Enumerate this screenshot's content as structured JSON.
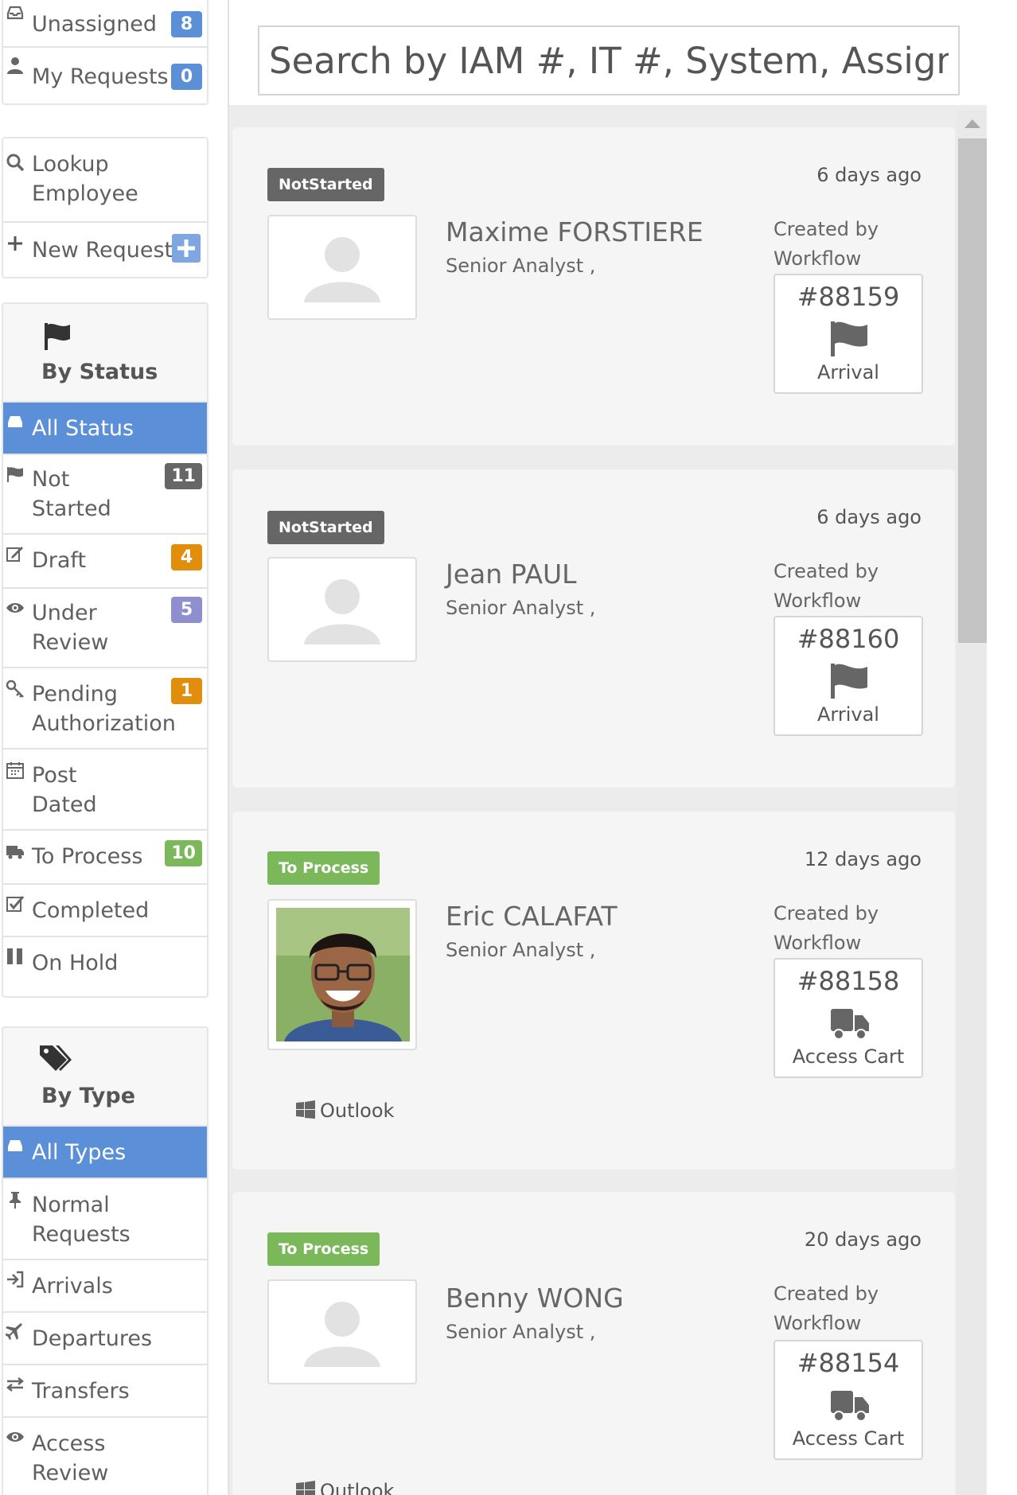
{
  "sidebar": {
    "top_items": [
      {
        "label": "Unassigned",
        "count": "8",
        "color": "#5b8fd8"
      },
      {
        "label": "My Requests",
        "count": "0",
        "color": "#5b8fd8"
      }
    ],
    "lookup_label": "Lookup Employee",
    "new_request_label": "New Request",
    "status_group": {
      "title": "By Status",
      "items": [
        {
          "label": "All Status",
          "count": ""
        },
        {
          "label": "Not Started",
          "count": "11",
          "color": "#666666"
        },
        {
          "label": "Draft",
          "count": "4",
          "color": "#e08e0b"
        },
        {
          "label": "Under Review",
          "count": "5",
          "color": "#8f8fd0"
        },
        {
          "label": "Pending Authorization",
          "count": "1",
          "color": "#e08e0b"
        },
        {
          "label": "Post Dated",
          "count": ""
        },
        {
          "label": "To Process",
          "count": "10",
          "color": "#7ab85a"
        },
        {
          "label": "Completed",
          "count": ""
        },
        {
          "label": "On Hold",
          "count": ""
        }
      ]
    },
    "type_group": {
      "title": "By Type",
      "items": [
        {
          "label": "All Types"
        },
        {
          "label": "Normal Requests"
        },
        {
          "label": "Arrivals"
        },
        {
          "label": "Departures"
        },
        {
          "label": "Transfers"
        },
        {
          "label": "Access Review"
        }
      ]
    }
  },
  "search": {
    "placeholder": "Search by IAM #, IT #, System, Assignee…"
  },
  "requests": [
    {
      "status": "NotStarted",
      "status_color": "#666666",
      "ago": "6 days ago",
      "name": "Maxime FORSTIERE",
      "title": "Senior Analyst ,",
      "created_by": "Created by Workflow",
      "number": "#88159",
      "type": "Arrival",
      "type_icon": "flag-icon",
      "apps": []
    },
    {
      "status": "NotStarted",
      "status_color": "#666666",
      "ago": "6 days ago",
      "name": "Jean PAUL",
      "title": "Senior Analyst ,",
      "created_by": "Created by Workflow",
      "number": "#88160",
      "type": "Arrival",
      "type_icon": "flag-icon",
      "apps": []
    },
    {
      "status": "To Process",
      "status_color": "#7ab85a",
      "ago": "12 days ago",
      "name": "Eric CALAFAT",
      "title": "Senior Analyst ,",
      "created_by": "Created by Workflow",
      "number": "#88158",
      "type": "Access Cart",
      "type_icon": "truck-icon",
      "apps": [
        "Outlook"
      ]
    },
    {
      "status": "To Process",
      "status_color": "#7ab85a",
      "ago": "20 days ago",
      "name": "Benny WONG",
      "title": "Senior Analyst ,",
      "created_by": "Created by Workflow",
      "number": "#88154",
      "type": "Access Cart",
      "type_icon": "truck-icon",
      "apps": [
        "Outlook"
      ]
    }
  ]
}
